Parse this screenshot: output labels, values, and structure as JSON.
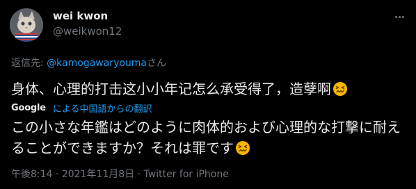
{
  "author": {
    "name": "wei kwon",
    "handle": "@weikwon12"
  },
  "reply": {
    "prefix": "返信先: ",
    "to": "@kamogawaryouma",
    "suffix": "さん"
  },
  "tweet": {
    "text": "身体、心理的打击这小小年记怎么承受得了，造孽啊",
    "emoji_icon": "confounded-face-icon"
  },
  "translation": {
    "provider": "Google",
    "label": "による中国語からの翻訳",
    "text": "この小さな年鑑はどのように肉体的および心理的な打撃に耐えることができますか？それは罪です",
    "emoji_icon": "confounded-face-icon"
  },
  "meta": {
    "time": "午後8:14",
    "separator1": " · ",
    "date": "2021年11月8日",
    "separator2": " · ",
    "source": "Twitter for iPhone"
  },
  "colors": {
    "background": "#000000",
    "text": "#e7e9ea",
    "secondary": "#71767b",
    "link": "#1d9bf0",
    "emoji": "#f7b500"
  }
}
